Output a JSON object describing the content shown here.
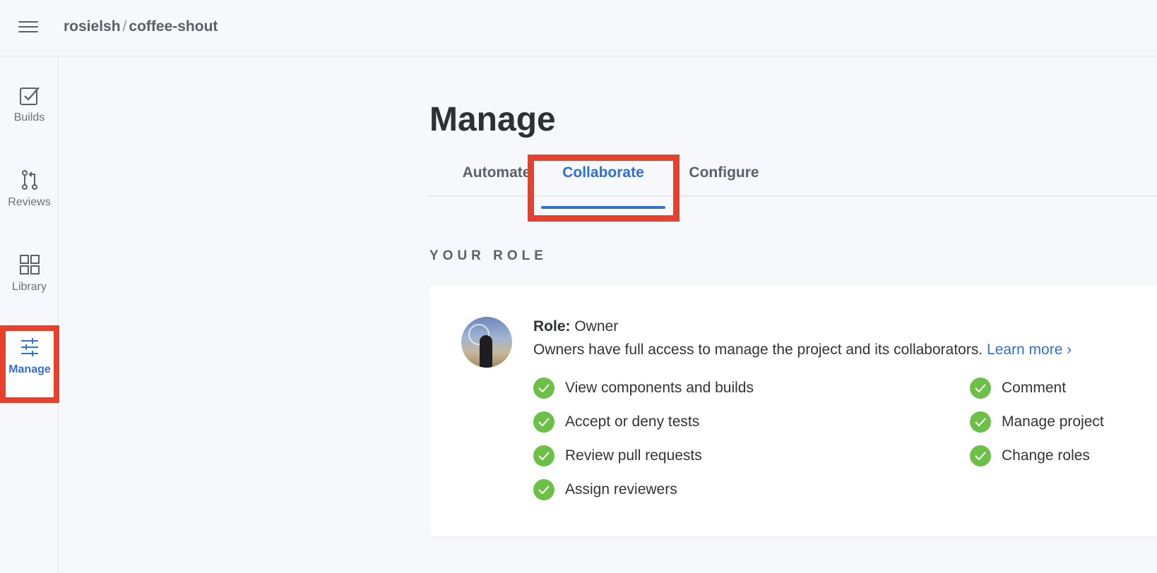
{
  "header": {
    "owner": "rosielsh",
    "separator": "/",
    "repo": "coffee-shout"
  },
  "sidebar": {
    "items": [
      {
        "label": "Builds",
        "icon": "checkbox-icon"
      },
      {
        "label": "Reviews",
        "icon": "pull-request-icon"
      },
      {
        "label": "Library",
        "icon": "grid-icon"
      },
      {
        "label": "Manage",
        "icon": "sliders-icon"
      }
    ],
    "active": "Manage"
  },
  "main": {
    "title": "Manage",
    "tabs": [
      {
        "label": "Automate"
      },
      {
        "label": "Collaborate"
      },
      {
        "label": "Configure"
      }
    ],
    "active_tab": "Collaborate",
    "section_title": "YOUR ROLE",
    "role": {
      "label": "Role:",
      "value": "Owner",
      "description": "Owners have full access to manage the project and its collaborators.",
      "learn_more": "Learn more",
      "learn_more_chevron": "›"
    },
    "permissions_left": [
      "View components and builds",
      "Accept or deny tests",
      "Review pull requests",
      "Assign reviewers"
    ],
    "permissions_right": [
      "Comment",
      "Manage project",
      "Change roles"
    ]
  },
  "colors": {
    "accent": "#2f6fd6",
    "highlight": "#e8402a",
    "success": "#6cc048"
  }
}
